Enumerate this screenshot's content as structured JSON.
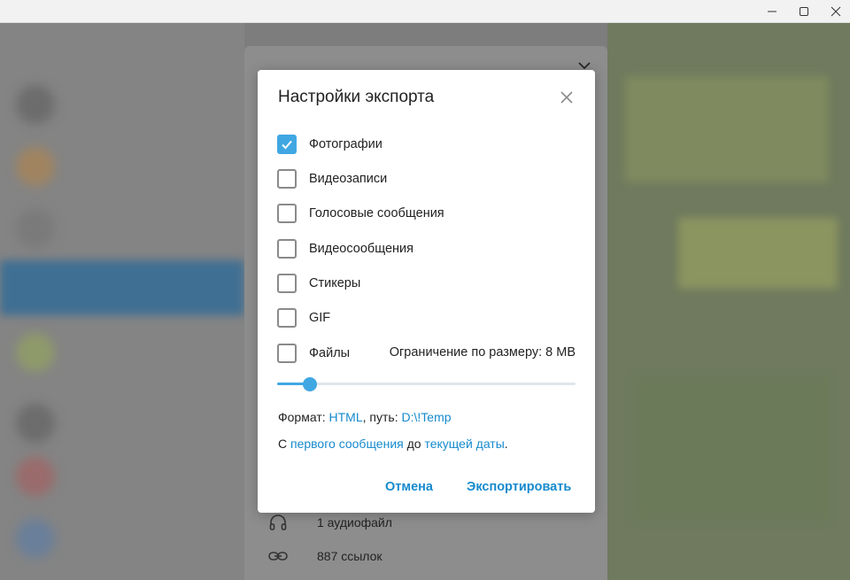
{
  "window": {
    "minimize_icon": "minimize-icon",
    "maximize_icon": "maximize-icon",
    "close_icon": "close-icon"
  },
  "profile_panel": {
    "rows": [
      {
        "icon": "headphones-icon",
        "text": "1 аудиофайл"
      },
      {
        "icon": "link-icon",
        "text": "887 ссылок"
      }
    ]
  },
  "dialog": {
    "title": "Настройки экспорта",
    "options": [
      {
        "label": "Фотографии",
        "checked": true
      },
      {
        "label": "Видеозаписи",
        "checked": false
      },
      {
        "label": "Голосовые сообщения",
        "checked": false
      },
      {
        "label": "Видеосообщения",
        "checked": false
      },
      {
        "label": "Стикеры",
        "checked": false
      },
      {
        "label": "GIF",
        "checked": false
      },
      {
        "label": "Файлы",
        "checked": false
      }
    ],
    "size_limit_label": "Ограничение по размеру: 8 MB",
    "slider_fraction": 0.09,
    "format": {
      "prefix": "Формат: ",
      "format_value": "HTML",
      "path_prefix": ", путь: ",
      "path_value": "D:\\!Temp"
    },
    "range": {
      "prefix": "С ",
      "from_value": "первого сообщения",
      "middle": " до ",
      "to_value": "текущей даты",
      "suffix": "."
    },
    "cancel_label": "Отмена",
    "export_label": "Экспортировать"
  },
  "colors": {
    "accent": "#40a7e3",
    "link": "#168acd"
  }
}
